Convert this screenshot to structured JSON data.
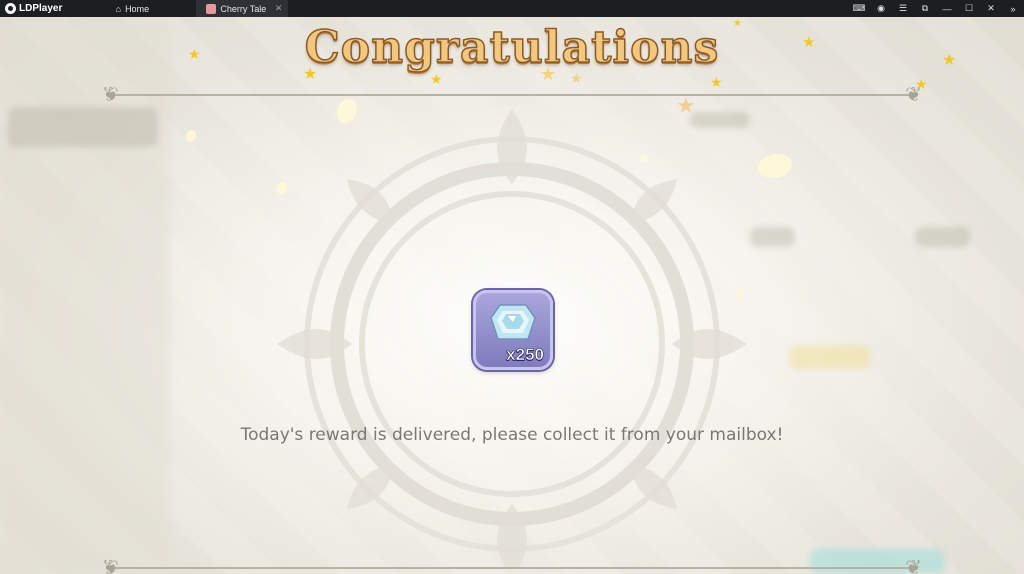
{
  "app": {
    "name": "LDPlayer"
  },
  "tabs": [
    {
      "label": "Home",
      "icon": "home-icon"
    },
    {
      "label": "Cherry Tale",
      "icon": "game-icon",
      "active": true
    }
  ],
  "window_controls": [
    "gamepad-icon",
    "account-icon",
    "menu-icon",
    "popout-icon",
    "minimize-icon",
    "maximize-icon",
    "close-icon",
    "expand-icon"
  ],
  "popup": {
    "title": "Congratulations",
    "reward": {
      "item": "diamond",
      "quantity": "x250"
    },
    "message": "Today's reward is delivered, please collect it from your mailbox!"
  },
  "colors": {
    "title_fill": "#f4c87c",
    "title_outline": "#8a5a2b",
    "reward_bg": "#8f8bcc",
    "star": "#f3c62c"
  }
}
